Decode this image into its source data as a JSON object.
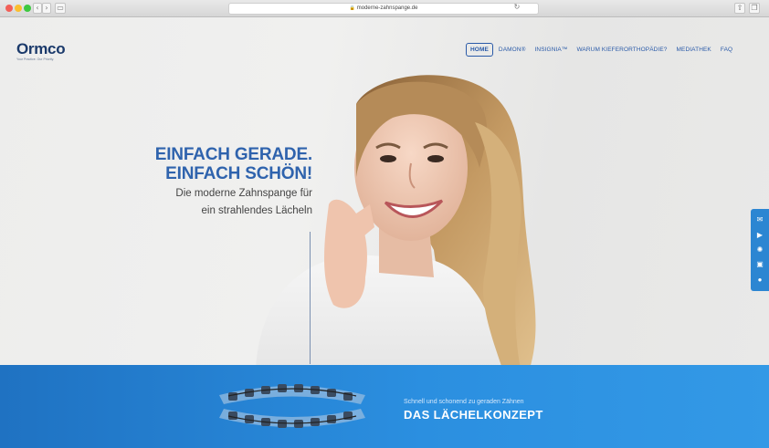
{
  "browser": {
    "url": "moderne-zahnspange.de",
    "back": "‹",
    "forward": "›",
    "reload": "↻"
  },
  "logo": {
    "name": "Ormco",
    "tagline": "Your Practice. Our Priority."
  },
  "nav": {
    "items": [
      {
        "label": "HOME",
        "active": true
      },
      {
        "label": "DAMON®",
        "active": false
      },
      {
        "label": "INSIGNIA™",
        "active": false
      },
      {
        "label": "WARUM KIEFERORTHOPÄDIE?",
        "active": false
      },
      {
        "label": "MEDIATHEK",
        "active": false
      },
      {
        "label": "FAQ",
        "active": false
      }
    ]
  },
  "hero": {
    "headline_1": "EINFACH GERADE.",
    "headline_2": "EINFACH SCHÖN!",
    "subline_1": "Die moderne Zahnspange für",
    "subline_2": "ein strahlendes Lächeln"
  },
  "side_icons": [
    "mail-icon",
    "play-icon",
    "loading-icon",
    "image-icon",
    "chat-icon"
  ],
  "banner": {
    "subtitle": "Schnell und schonend zu geraden Zähnen",
    "title": "DAS LÄCHELKONZEPT"
  },
  "colors": {
    "brand_blue": "#2f63ad",
    "banner_blue": "#2b8fe0",
    "logo_navy": "#1b3a6b"
  }
}
